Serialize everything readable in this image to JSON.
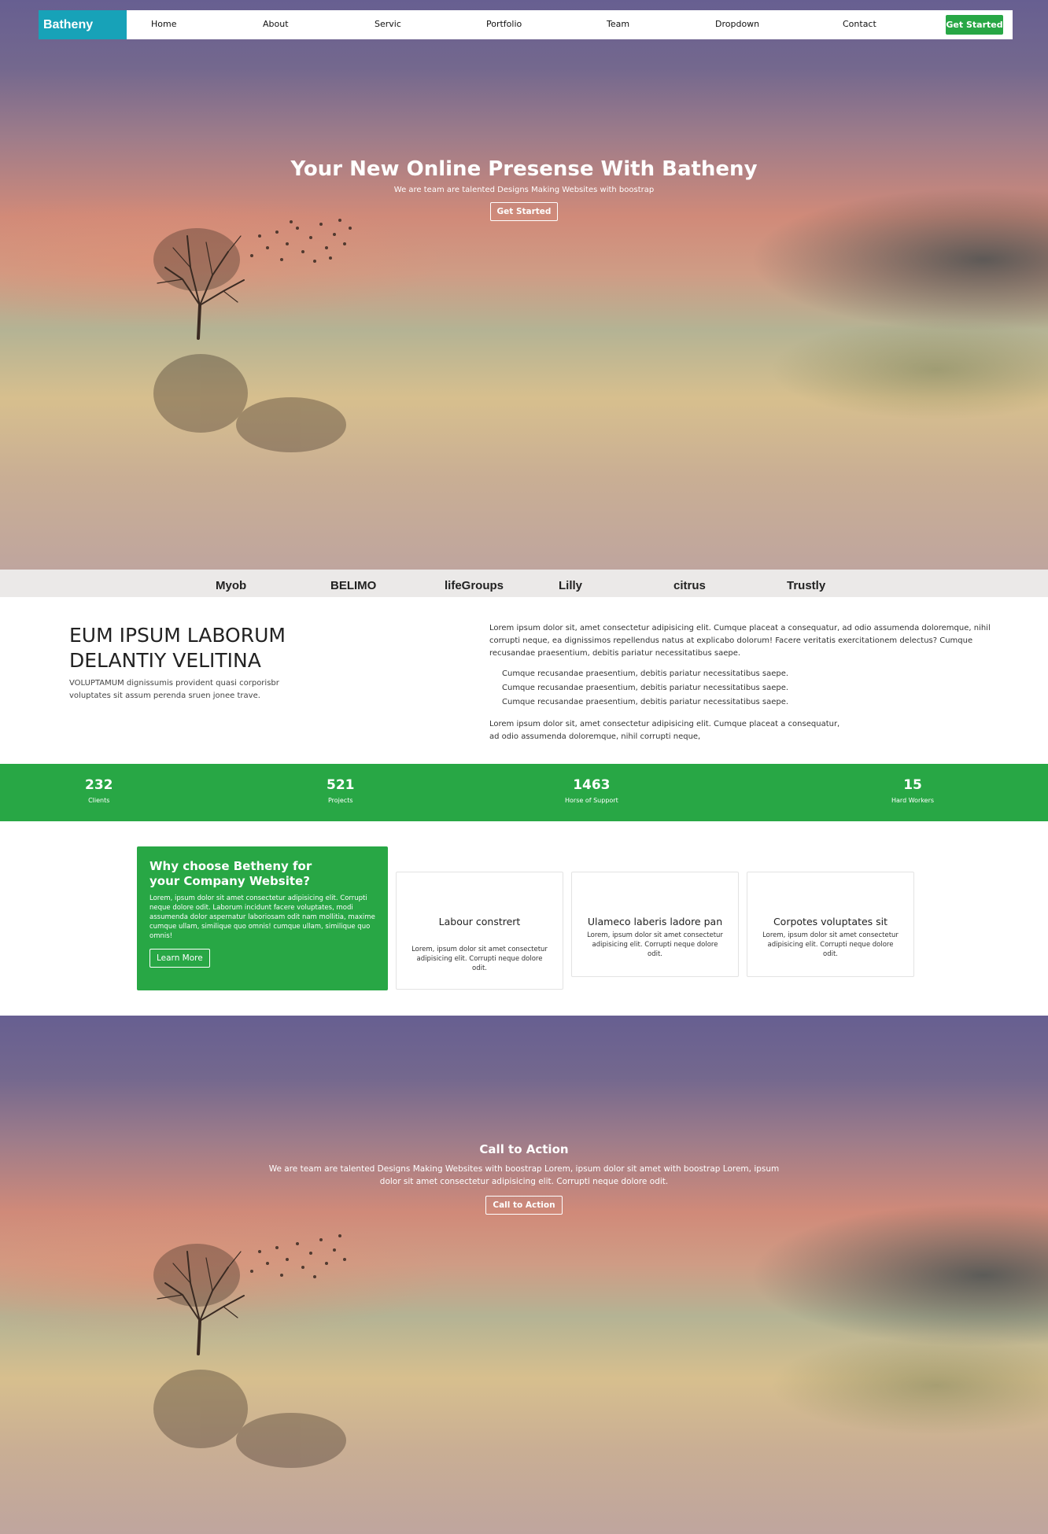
{
  "nav": {
    "brand": "Batheny",
    "links": [
      "Home",
      "About",
      "Servic",
      "Portfolio",
      "Team",
      "Dropdown",
      "Contact"
    ],
    "cta": "Get Started"
  },
  "hero": {
    "title": "Your New Online Presense With Batheny",
    "subtitle": "We are team are talented Designs Making Websites with boostrap",
    "button": "Get Started"
  },
  "clients": [
    "Myob",
    "BELIMO",
    "lifeGroups",
    "Lilly",
    "citrus",
    "Trustly"
  ],
  "about": {
    "heading_line1": "EUM IPSUM LABORUM",
    "heading_line2": "DELANTIY VELITINA",
    "subtext": "VOLUPTAMUM dignissumis provident quasi corporisbr voluptates sit assum perenda sruen jonee trave.",
    "para1": "Lorem ipsum dolor sit, amet consectetur adipisicing elit. Cumque placeat a consequatur, ad odio assumenda doloremque, nihil corrupti neque, ea dignissimos repellendus natus at explicabo dolorum! Facere veritatis exercitationem delectus? Cumque recusandae praesentium, debitis pariatur necessitatibus saepe.",
    "list": [
      "Cumque recusandae praesentium, debitis pariatur necessitatibus saepe.",
      "Cumque recusandae praesentium, debitis pariatur necessitatibus saepe.",
      "Cumque recusandae praesentium, debitis pariatur necessitatibus saepe."
    ],
    "para2_line1": "Lorem ipsum dolor sit, amet consectetur adipisicing elit. Cumque placeat a consequatur,",
    "para2_line2": "ad odio assumenda doloremque, nihil corrupti neque,"
  },
  "stats": [
    {
      "value": "232",
      "label": "Clients"
    },
    {
      "value": "521",
      "label": "Projects"
    },
    {
      "value": "1463",
      "label": "Horse of Support"
    },
    {
      "value": "15",
      "label": "Hard Workers"
    }
  ],
  "why": {
    "title": "Why choose Betheny for your Company Website?",
    "text": "Lorem, ipsum dolor sit amet consectetur adipisicing elit. Corrupti neque dolore odit. Laborum incidunt facere voluptates, modi assumenda dolor aspernatur laboriosam odit nam mollitia, maxime cumque ullam, similique quo omnis! cumque ullam, similique quo omnis!",
    "button": "Learn More"
  },
  "cards": [
    {
      "title": "Labour constrert",
      "text": "Lorem, ipsum dolor sit amet consectetur adipisicing elit. Corrupti neque dolore odit."
    },
    {
      "title": "Ulameco laberis ladore pan",
      "text": "Lorem, ipsum dolor sit amet consectetur adipisicing elit. Corrupti neque dolore odit."
    },
    {
      "title": "Corpotes voluptates sit",
      "text": "Lorem, ipsum dolor sit amet consectetur adipisicing elit. Corrupti neque dolore odit."
    }
  ],
  "cta": {
    "title": "Call to Action",
    "text": "We are team are talented Designs Making Websites with boostrap Lorem, ipsum dolor sit amet with boostrap Lorem, ipsum dolor sit amet consectetur adipisicing elit. Corrupti neque dolore odit.",
    "button": "Call to Action"
  },
  "colors": {
    "brand": "#17a2b8",
    "accent": "#28a745"
  }
}
